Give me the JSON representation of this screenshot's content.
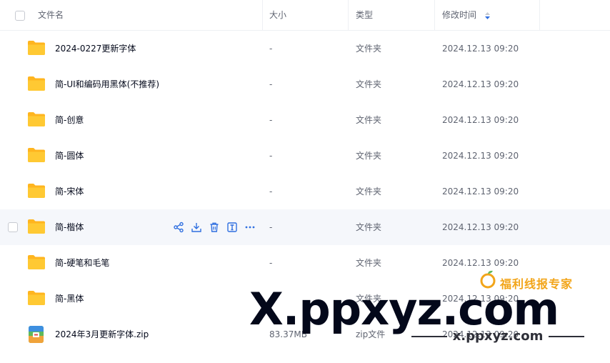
{
  "header": {
    "col_name": "文件名",
    "col_size": "大小",
    "col_type": "类型",
    "col_time": "修改时间"
  },
  "rows": [
    {
      "name": "2024-0227更新字体",
      "size": "-",
      "type": "文件夹",
      "time": "2024.12.13 09:20",
      "icon": "folder-icon"
    },
    {
      "name": "简-UI和编码用黑体(不推荐)",
      "size": "-",
      "type": "文件夹",
      "time": "2024.12.13 09:20",
      "icon": "folder-icon"
    },
    {
      "name": "简-创意",
      "size": "-",
      "type": "文件夹",
      "time": "2024.12.13 09:20",
      "icon": "folder-icon"
    },
    {
      "name": "简-圆体",
      "size": "-",
      "type": "文件夹",
      "time": "2024.12.13 09:20",
      "icon": "folder-icon"
    },
    {
      "name": "简-宋体",
      "size": "-",
      "type": "文件夹",
      "time": "2024.12.13 09:20",
      "icon": "folder-icon"
    },
    {
      "name": "简-楷体",
      "size": "-",
      "type": "文件夹",
      "time": "2024.12.13 09:20",
      "icon": "folder-icon"
    },
    {
      "name": "简-硬笔和毛笔",
      "size": "-",
      "type": "文件夹",
      "time": "2024.12.13 09:20",
      "icon": "folder-icon"
    },
    {
      "name": "简-黑体",
      "size": "-",
      "type": "文件夹",
      "time": "2024.12.13 09:20",
      "icon": "folder-icon"
    },
    {
      "name": "2024年3月更新字体.zip",
      "size": "83.37MB",
      "type": "zip文件",
      "time": "2024.12.13 09:20",
      "icon": "zip-archive-icon"
    }
  ],
  "hover_actions": [
    "share-icon",
    "download-icon",
    "delete-icon",
    "rename-icon",
    "more-icon"
  ],
  "watermark": {
    "tagline": "福利线报专家",
    "big": "X.ppxyz.com",
    "small": "x.ppxyz.com"
  },
  "colors": {
    "folder": "#ffc933",
    "action_blue": "#2f6fe0",
    "watermark_pink": "#e6195f",
    "hover_row": "#f5f7fb"
  }
}
